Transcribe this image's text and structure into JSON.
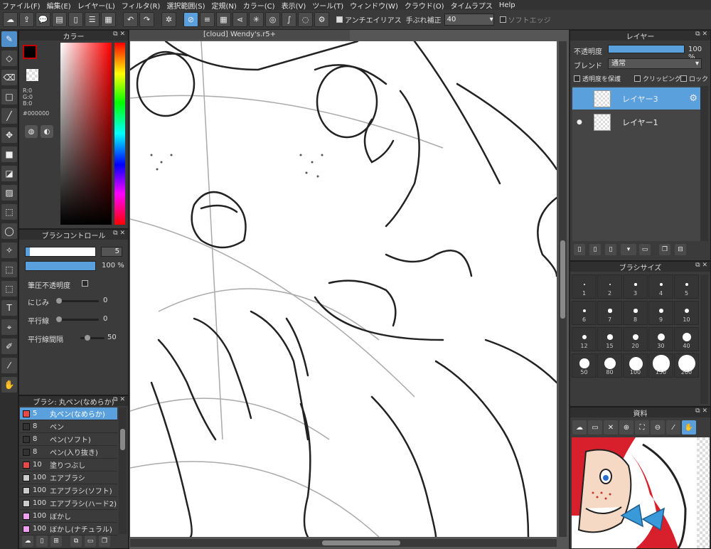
{
  "menu": [
    "ファイル(F)",
    "編集(E)",
    "レイヤー(L)",
    "フィルタ(R)",
    "選択範囲(S)",
    "定規(N)",
    "カラー(C)",
    "表示(V)",
    "ツール(T)",
    "ウィンドウ(W)",
    "クラウド(O)",
    "タイムラプス",
    "Help"
  ],
  "toolbar": {
    "antialias_label": "アンチエイリアス",
    "stabilizer_label": "手ぶれ補正",
    "stabilizer_value": "40",
    "softedge_label": "ソフトエッジ"
  },
  "color_panel": {
    "title": "カラー",
    "r": "R:0",
    "g": "G:0",
    "b": "B:0",
    "hex": "#000000",
    "fg_color": "#000000"
  },
  "brush_control": {
    "title": "ブラシコントロール",
    "size_value": "5",
    "opacity_value": "100 %",
    "pressure_label": "筆圧不透明度",
    "blur_label": "にじみ",
    "blur_value": "0",
    "parallel_label": "平行線",
    "parallel_value": "0",
    "interval_label": "平行線間隔",
    "interval_value": "50"
  },
  "brush_list": {
    "title": "ブラシ: 丸ペン(なめらか)",
    "items": [
      {
        "size": "5",
        "name": "丸ペン(なめらか)",
        "color": "#e84a4a"
      },
      {
        "size": "8",
        "name": "ペン",
        "color": "#333333"
      },
      {
        "size": "8",
        "name": "ペン(ソフト)",
        "color": "#333333"
      },
      {
        "size": "8",
        "name": "ペン(入り抜き)",
        "color": "#333333"
      },
      {
        "size": "10",
        "name": "塗りつぶし",
        "color": "#e84a4a"
      },
      {
        "size": "100",
        "name": "エアブラシ",
        "color": "#cccccc"
      },
      {
        "size": "100",
        "name": "エアブラシ(ソフト)",
        "color": "#cccccc"
      },
      {
        "size": "100",
        "name": "エアブラシ(ハード2)",
        "color": "#cccccc"
      },
      {
        "size": "100",
        "name": "ぼかし",
        "color": "#f0a0f0"
      },
      {
        "size": "100",
        "name": "ぼかし(ナチュラル)",
        "color": "#f0a0f0"
      }
    ]
  },
  "canvas": {
    "doc_title": "[cloud] Wendy's.r5+"
  },
  "layer_panel": {
    "title": "レイヤー",
    "opacity_label": "不透明度",
    "opacity_value": "100 %",
    "blend_label": "ブレンド",
    "blend_value": "通常",
    "protect_label": "透明度を保護",
    "clip_label": "クリッピング",
    "lock_label": "ロック",
    "layers": [
      {
        "name": "レイヤー3"
      },
      {
        "name": "レイヤー1"
      }
    ]
  },
  "brush_size_panel": {
    "title": "ブラシサイズ",
    "sizes": [
      "1",
      "2",
      "3",
      "4",
      "5",
      "6",
      "7",
      "8",
      "9",
      "10",
      "12",
      "15",
      "20",
      "30",
      "40",
      "50",
      "80",
      "100",
      "150",
      "200"
    ]
  },
  "material_panel": {
    "title": "資料"
  }
}
